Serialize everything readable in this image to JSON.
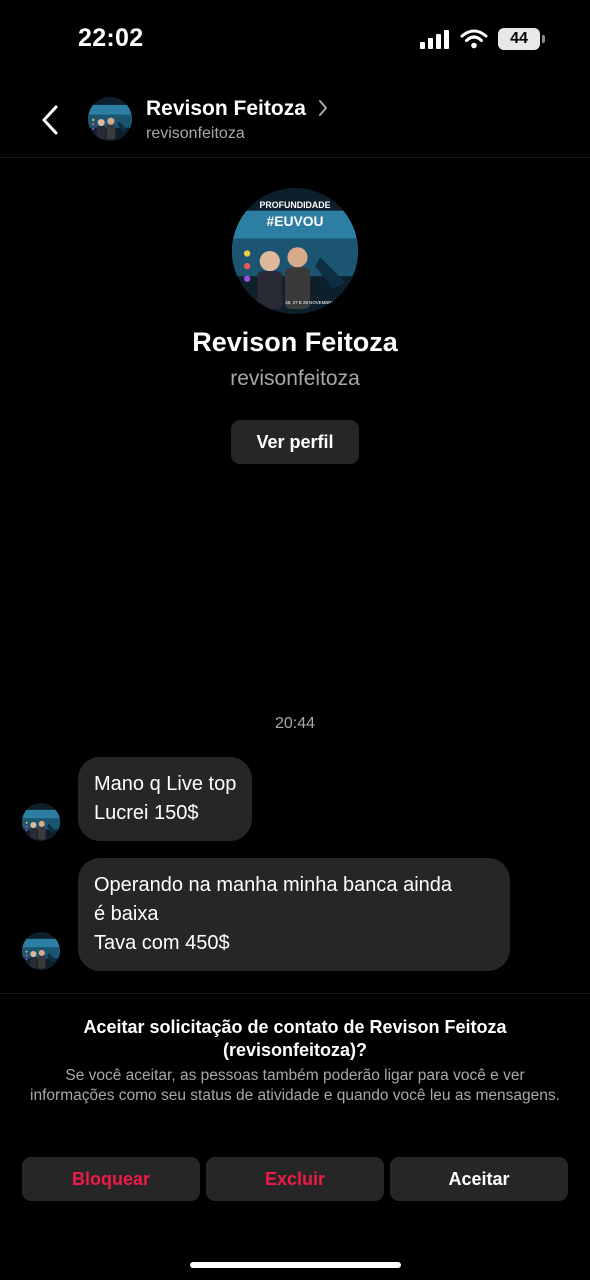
{
  "status_bar": {
    "time": "22:02",
    "battery": "44",
    "signal_icon": "cellular-signal-icon",
    "wifi_icon": "wifi-icon"
  },
  "header": {
    "name": "Revison Feitoza",
    "username": "revisonfeitoza",
    "back_icon": "chevron-left-icon",
    "chevron_icon": "chevron-right-icon"
  },
  "profile": {
    "name": "Revison Feitoza",
    "username": "revisonfeitoza",
    "view_profile_label": "Ver perfil",
    "avatar_text": "PROFUNDIDADE",
    "avatar_hashtag": "#EUVOU",
    "avatar_dates": "26, 27 E 28 NOVEMBRO"
  },
  "chat": {
    "timestamp": "20:44",
    "messages": [
      {
        "lines": [
          "Mano q Live top",
          "Lucrei 150$"
        ]
      },
      {
        "lines": [
          "Operando na manha minha banca ainda",
          "é baixa",
          "Tava com 450$"
        ]
      }
    ]
  },
  "request": {
    "title": "Aceitar solicitação de contato de Revison Feitoza (revisonfeitoza)?",
    "description": "Se você aceitar, as pessoas também poderão ligar para você e ver informações como seu status de atividade e quando você leu as mensagens.",
    "block_label": "Bloquear",
    "delete_label": "Excluir",
    "accept_label": "Aceitar"
  },
  "colors": {
    "background": "#000000",
    "bubble": "#262626",
    "danger": "#ed1b46",
    "muted": "#a8a8a8"
  }
}
